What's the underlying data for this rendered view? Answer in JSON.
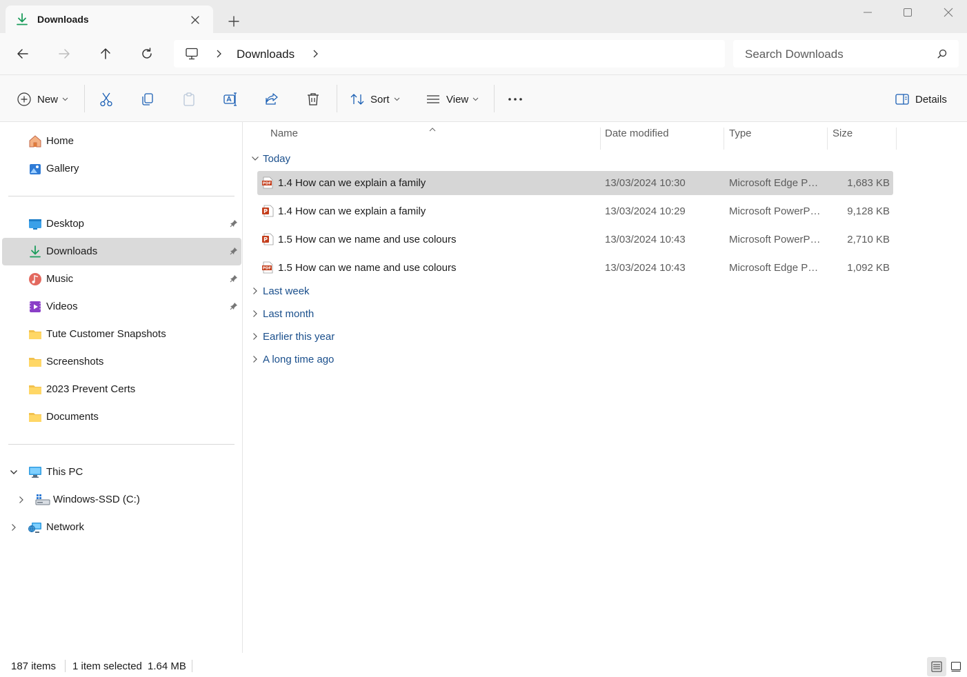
{
  "tab": {
    "title": "Downloads"
  },
  "breadcrumb": {
    "items": [
      "Downloads"
    ]
  },
  "search": {
    "placeholder": "Search Downloads"
  },
  "toolbar": {
    "new_label": "New",
    "sort_label": "Sort",
    "view_label": "View",
    "details_label": "Details"
  },
  "sidebar": {
    "quick": [
      {
        "label": "Home",
        "icon": "home-icon"
      },
      {
        "label": "Gallery",
        "icon": "gallery-icon"
      }
    ],
    "pinned": [
      {
        "label": "Desktop",
        "icon": "desktop-folder-icon",
        "pinned": true
      },
      {
        "label": "Downloads",
        "icon": "download-icon",
        "pinned": true,
        "selected": true
      },
      {
        "label": "Music",
        "icon": "music-icon",
        "pinned": true
      },
      {
        "label": "Videos",
        "icon": "videos-icon",
        "pinned": true
      },
      {
        "label": "Tute Customer Snapshots",
        "icon": "folder-icon"
      },
      {
        "label": "Screenshots",
        "icon": "folder-icon"
      },
      {
        "label": "2023 Prevent Certs",
        "icon": "folder-icon"
      },
      {
        "label": "Documents",
        "icon": "folder-icon"
      }
    ],
    "tree": [
      {
        "label": "This PC",
        "icon": "pc-icon",
        "expanded": true
      },
      {
        "label": "Windows-SSD (C:)",
        "icon": "drive-icon"
      },
      {
        "label": "Network",
        "icon": "network-icon"
      }
    ]
  },
  "columns": {
    "name": "Name",
    "date": "Date modified",
    "type": "Type",
    "size": "Size"
  },
  "groups": {
    "today": "Today",
    "last_week": "Last week",
    "last_month": "Last month",
    "earlier_year": "Earlier this year",
    "long_ago": "A long time ago"
  },
  "files": [
    {
      "name": "1.4 How can we explain a family",
      "date": "13/03/2024 10:30",
      "type": "Microsoft Edge PD...",
      "size": "1,683 KB",
      "icon": "pdf-icon",
      "selected": true
    },
    {
      "name": "1.4 How can we explain a family",
      "date": "13/03/2024 10:29",
      "type": "Microsoft PowerPo...",
      "size": "9,128 KB",
      "icon": "powerpoint-icon"
    },
    {
      "name": "1.5 How can we name and use colours",
      "date": "13/03/2024 10:43",
      "type": "Microsoft PowerPo...",
      "size": "2,710 KB",
      "icon": "powerpoint-icon"
    },
    {
      "name": "1.5 How can we name and use colours",
      "date": "13/03/2024 10:43",
      "type": "Microsoft Edge PD...",
      "size": "1,092 KB",
      "icon": "pdf-icon"
    }
  ],
  "status": {
    "items_count": "187 items",
    "selection": "1 item selected",
    "selection_size": "1.64 MB"
  },
  "colors": {
    "accent": "#0067c0",
    "group_header": "#1a4f8c",
    "selection": "#d6d6d6",
    "download_green": "#1a9c5b",
    "pdf_red": "#c43e1c"
  }
}
